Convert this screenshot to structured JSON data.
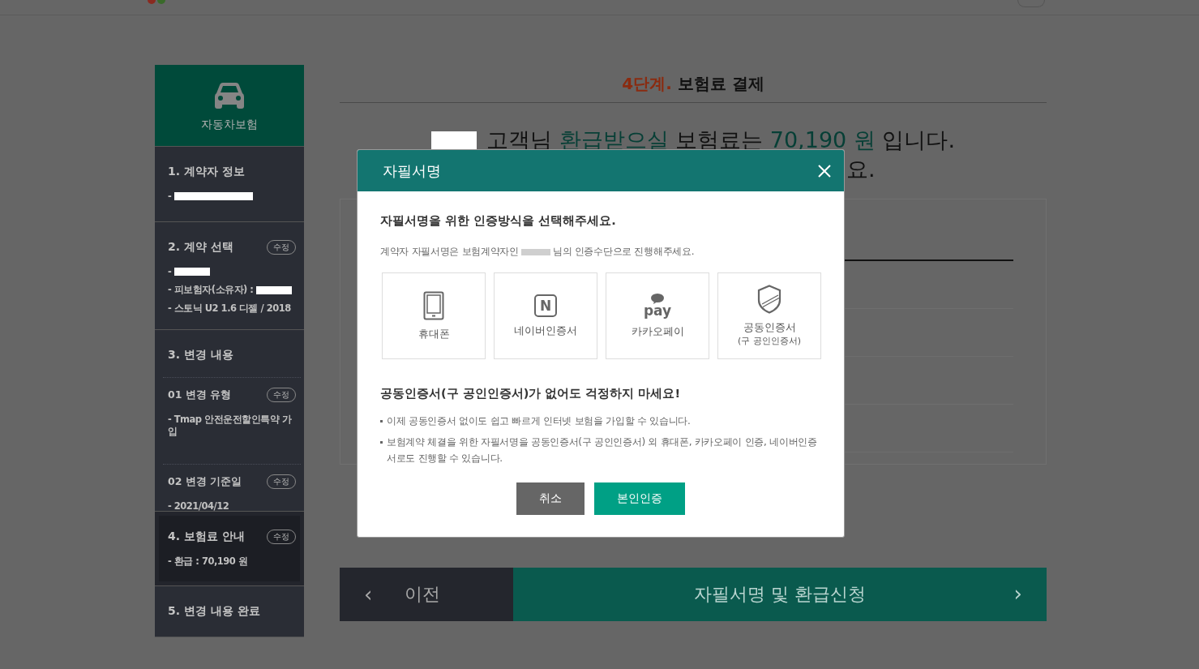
{
  "sidebar": {
    "title": "자동차보험",
    "steps": [
      {
        "title": "1. 계약자 정보",
        "active": false,
        "lines": [
          {
            "text": "-",
            "redacted": true
          }
        ]
      },
      {
        "title": "2. 계약 선택",
        "active": false,
        "edit": "수정",
        "lines": [
          {
            "text": "-",
            "redacted": true
          },
          {
            "text": "- 피보험자(소유자) :",
            "redacted": true
          },
          {
            "text": "- 스토닉 U2 1.6 디젤 / 2018",
            "redacted": false
          }
        ]
      },
      {
        "title": "3. 변경 내용",
        "active": false,
        "substeps": [
          {
            "title": "01 변경 유형",
            "edit": "수정",
            "lines": [
              {
                "text": "- Tmap 안전운전할인특약 가입",
                "redacted": false
              }
            ]
          },
          {
            "title": "02 변경 기준일",
            "edit": "수정",
            "lines": [
              {
                "text": "- 2021/04/12",
                "redacted": false
              }
            ]
          }
        ]
      },
      {
        "title": "4. 보험료 안내",
        "active": true,
        "edit": "수정",
        "lines": [
          {
            "text": "- 환급 : 70,190 원",
            "redacted": false
          }
        ]
      },
      {
        "title": "5. 변경 내용 완료",
        "active": false
      }
    ]
  },
  "main": {
    "step_label": "4단계.",
    "title": "보험료 결제",
    "message": [
      {
        "text": "고객님 ",
        "highlight": false
      },
      {
        "text": "환급받으실",
        "highlight": true
      },
      {
        "text": " 보험료는 ",
        "highlight": false
      },
      {
        "text": "70,190 원",
        "highlight": true
      },
      {
        "text": " 입니다.",
        "highlight": false
      }
    ],
    "message_line2": "요."
  },
  "modal": {
    "title": "자필서명",
    "heading": "자필서명을 위한 인증방식을 선택해주세요.",
    "notice_before": "계약자 자필서명은 보험계약자인",
    "notice_after": "님의 인증수단으로 진행해주세요.",
    "options": [
      {
        "kind": "phone",
        "label": "휴대폰"
      },
      {
        "kind": "naver",
        "icon_text": "N",
        "label": "네이버인증서"
      },
      {
        "kind": "kakao",
        "icon_text": "pay",
        "label": "카카오페이"
      },
      {
        "kind": "shield",
        "label": "공동인증서",
        "sublabel": "(구 공인인증서)"
      }
    ],
    "section_heading": "공동인증서(구 공인인증서)가 없어도 걱정하지 마세요!",
    "bullets": [
      "이제 공동인증서 없이도 쉽고 빠르게 인터넷 보험을 가입할 수 있습니다.",
      "보험계약 체결을 위한 자필서명을 공동인증서(구 공인인증서) 외 휴대폰, 카카오페이 인증, 네이버인증서로도 진행할 수 있습니다."
    ],
    "buttons": [
      {
        "kind": "cancel",
        "label": "취소"
      },
      {
        "kind": "primary",
        "label": "본인인증"
      }
    ]
  },
  "nav": {
    "prev_icon": "‹",
    "prev": "이전",
    "next": "자필서명 및 환급신청",
    "next_icon": "›"
  }
}
